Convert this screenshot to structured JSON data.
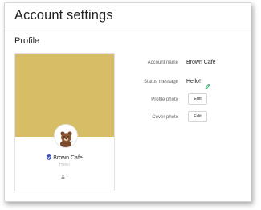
{
  "header": {
    "title": "Account settings"
  },
  "profile": {
    "section_title": "Profile",
    "card": {
      "cover_color": "#d6bd66",
      "avatar_icon": "brown-bear-avatar-icon",
      "badge_icon": "official-shield-badge-icon",
      "name": "Brown Cafe",
      "status": "Hello!",
      "friends_icon": "person-icon",
      "friends_count": "1"
    },
    "fields": {
      "account_name_label": "Account name",
      "account_name_value": "Brown Cafe",
      "status_message_label": "Status message",
      "status_message_value": "Hello!",
      "status_edit_icon": "pencil-icon",
      "profile_photo_label": "Profile photo",
      "profile_photo_button": "Edit",
      "cover_photo_label": "Cover photo",
      "cover_photo_button": "Edit"
    },
    "accent_color": "#2cb36b"
  }
}
